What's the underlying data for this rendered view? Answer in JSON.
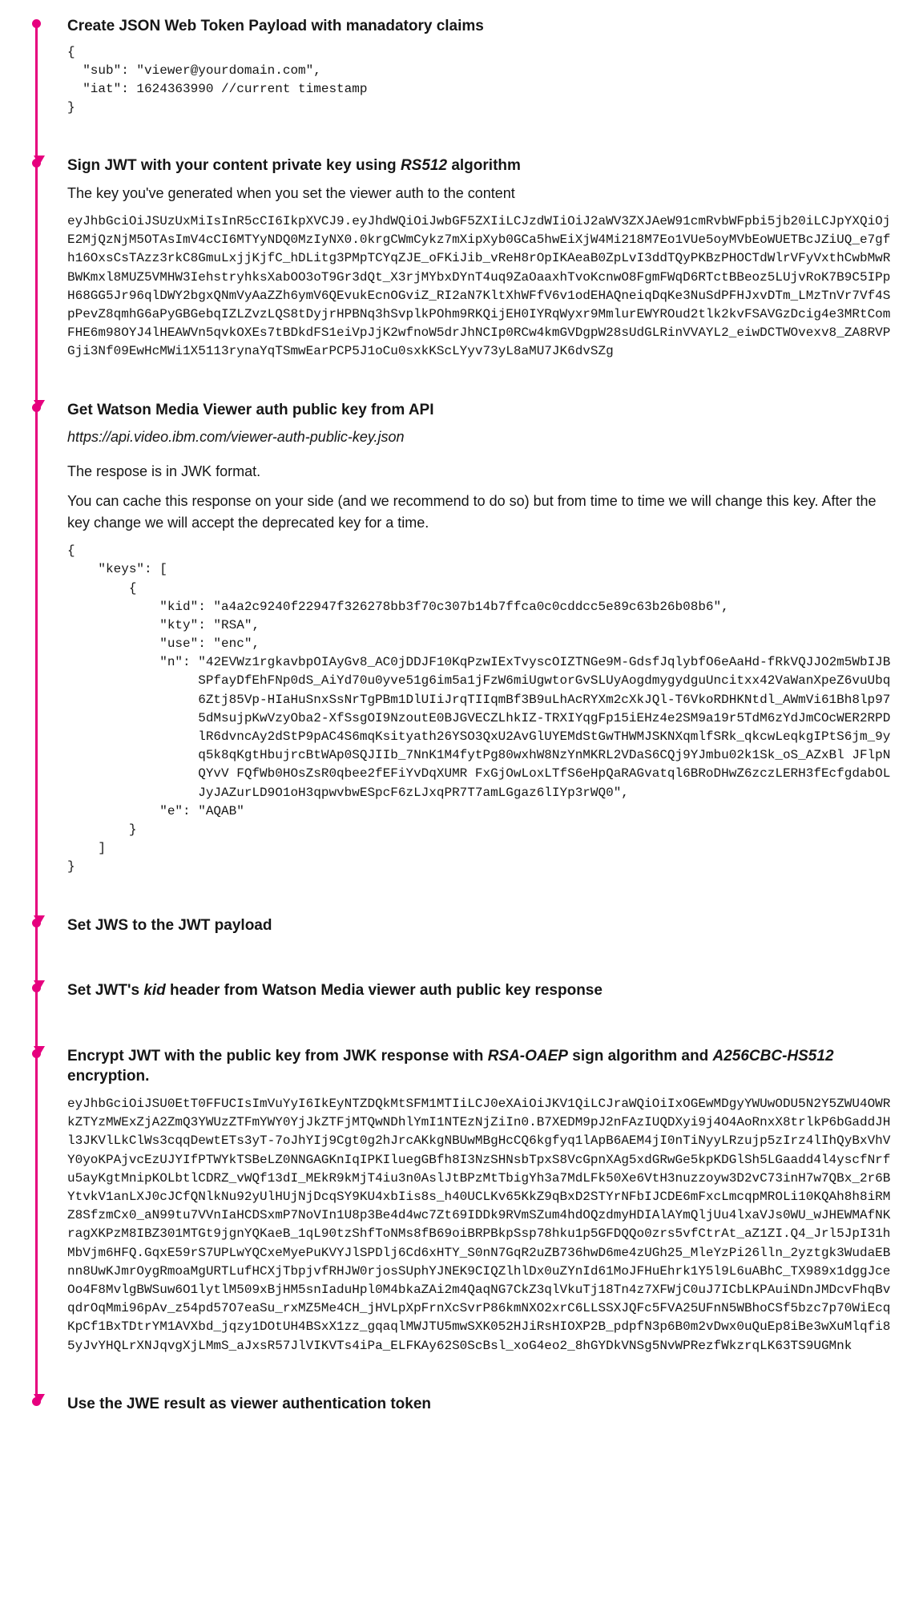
{
  "steps": {
    "s1": {
      "title": "Create JSON Web Token Payload with manadatory claims",
      "code": "{\n  \"sub\": \"viewer@yourdomain.com\",\n  \"iat\": 1624363990 //current timestamp\n}"
    },
    "s2": {
      "title_pre": "Sign JWT with your content private key using ",
      "title_em": "RS512",
      "title_post": " algorithm",
      "desc": "The key you've generated when you set the viewer auth to the content",
      "token": "eyJhbGciOiJSUzUxMiIsInR5cCI6IkpXVCJ9.eyJhdWQiOiJwbGF5ZXIiLCJzdWIiOiJ2aWV3ZXJAeW91cmRvbWFpbi5jb20iLCJpYXQiOjE2MjQzNjM5OTAsImV4cCI6MTYyNDQ0MzIyNX0.0krgCWmCykz7mXipXyb0GCa5hwEiXjW4Mi218M7Eo1VUe5oyMVbEoWUETBcJZiUQ_e7gfh16OxsCsTAzz3rkC8GmuLxjjKjfC_hDLitg3PMpTCYqZJE_oFKiJib_vReH8rOpIKAeaB0ZpLvI3ddTQyPKBzPHOCTdWlrVFyVxthCwbMwRBWKmxl8MUZ5VMHW3IehstryhksXabOO3oT9Gr3dQt_X3rjMYbxDYnT4uq9ZaOaaxhTvoKcnwO8FgmFWqD6RTctBBeoz5LUjvRoK7B9C5IPpH68GG5Jr96qlDWY2bgxQNmVyAaZZh6ymV6QEvukEcnOGviZ_RI2aN7KltXhWFfV6v1odEHAQneiqDqKe3NuSdPFHJxvDTm_LMzTnVr7Vf4SpPevZ8qmhG6aPyGBGebqIZLZvzLQS8tDyjrHPBNq3hSvplkPOhm9RKQijEH0IYRqWyxr9MmlurEWYROud2tlk2kvFSAVGzDcig4e3MRtComFHE6m98OYJ4lHEAWVn5qvkOXEs7tBDkdFS1eiVpJjK2wfnoW5drJhNCIp0RCw4kmGVDgpW28sUdGLRinVVAYL2_eiwDCTWOvexv8_ZA8RVPGji3Nf09EwHcMWi1X5113rynaYqTSmwEarPCP5J1oCu0sxkKScLYyv73yL8aMU7JK6dvSZg"
    },
    "s3": {
      "title": "Get Watson Media Viewer auth public key from API",
      "url": "https://api.video.ibm.com/viewer-auth-public-key.json",
      "desc1": "The respose is in JWK format.",
      "desc2": "You can cache this response on your side (and we recommend to do so) but from time to time we will change this key. After the key change we will accept the deprecated key for a time.",
      "jwk_open": "{\n    \"keys\": [\n        {\n            \"kid\": \"a4a2c9240f22947f326278bb3f70c307b14b7ffca0c0cddcc5e89c63b26b08b6\",\n            \"kty\": \"RSA\",\n            \"use\": \"enc\",",
      "n_label": "\"n\": ",
      "n_value": "\"42EVWz1rgkavbpOIAyGv8_AC0jDDJF10KqPzwIExTvyscOIZTNGe9M-GdsfJqlybfO6eAaHd-fRkVQJJO2m5WbIJBSPfayDfEhFNp0dS_AiYd70u0yve51g6im5a1jFzW6miUgwtorGvSLUyAogdmygydguUncitxx42VaWanXpeZ6vuUbq6Ztj85Vp-HIaHuSnxSsNrTgPBm1DlUIiJrqTIIqmBf3B9uLhAcRYXm2cXkJQl-T6VkoRDHKNtdl_AWmVi61Bh8lp975dMsujpKwVzyOba2-XfSsgOI9NzoutE0BJGVECZLhkIZ-TRXIYqgFp15iEHz4e2SM9a19r5TdM6zYdJmCOcWER2RPDlR6dvncAy2dStP9pAC4S6mqKsityath26YSO3QxU2AvGlUYEMdStGwTHWMJSKNXqmlfSRk_qkcwLeqkgIPtS6jm_9yq5k8qKgtHbujrcBtWAp0SQJIIb_7NnK1M4fytPg80wxhW8NzYnMKRL2VDaS6CQj9YJmbu02k1Sk_oS_AZxBl JFlpNQYvV FQfWb0HOsZsR0qbee2fEFiYvDqXUMR FxGjOwLoxLTfS6eHpQaRAGvatql6BRoDHwZ6zczLERH3fEcfgdabOLJyJAZurLD9O1oH3qpwvbwESpcF6zLJxqPR7T7amLGgaz6lIYp3rWQ0\",",
      "jwk_close": "            \"e\": \"AQAB\"\n        }\n    ]\n}"
    },
    "s4": {
      "title": "Set JWS to the JWT payload"
    },
    "s5": {
      "title_pre": "Set JWT's ",
      "title_em": "kid",
      "title_post": " header from Watson Media viewer auth public key response"
    },
    "s6": {
      "title_pre": "Encrypt JWT with the public key from JWK response with ",
      "title_em1": "RSA-OAEP",
      "title_mid": " sign algorithm and ",
      "title_em2": "A256CBC-HS512",
      "title_post": " encryption.",
      "token": "eyJhbGciOiJSU0EtT0FFUCIsImVuYyI6IkEyNTZDQkMtSFM1MTIiLCJ0eXAiOiJKV1QiLCJraWQiOiIxOGEwMDgyYWUwODU5N2Y5ZWU4OWRkZTYzMWExZjA2ZmQ3YWUzZTFmYWY0YjJkZTFjMTQwNDhlYmI1NTEzNjZiIn0.B7XEDM9pJ2nFAzIUQDXyi9j4O4AoRnxX8trlkP6bGaddJHl3JKVlLkClWs3cqqDewtETs3yT-7oJhYIj9Cgt0g2hJrcAKkgNBUwMBgHcCQ6kgfyq1lApB6AEM4jI0nTiNyyLRzujp5zIrz4lIhQyBxVhVY0yoKPAjvcEzUJYIfPTWYkTSBeLZ0NNGAGKnIqIPKIluegGBfh8I3NzSHNsbTpxS8VcGpnXAg5xdGRwGe5kpKDGlSh5LGaadd4l4yscfNrfu5ayKgtMnipKOLbtlCDRZ_vWQf13dI_MEkR9kMjT4iu3n0AslJtBPzMtTbigYh3a7MdLFk50Xe6VtH3nuzzoyw3D2vC73inH7w7QBx_2r6BYtvkV1anLXJ0cJCfQNlkNu92yUlHUjNjDcqSY9KU4xbIis8s_h40UCLKv65KkZ9qBxD2STYrNFbIJCDE6mFxcLmcqpMROLi10KQAh8h8iRMZ8SfzmCx0_aN99tu7VVnIaHCDSxmP7NoVIn1U8p3Be4d4wc7Zt69IDDk9RVmSZum4hdOQzdmyHDIAlAYmQljUu4lxaVJs0WU_wJHEWMAfNKragXKPzM8IBZ301MTGt9jgnYQKaeB_1qL90tzShfToNMs8fB69oiBRPBkpSsp78hku1p5GFDQQo0zrs5vfCtrAt_aZ1ZI.Q4_Jrl5JpI31hMbVjm6HFQ.GqxE59rS7UPLwYQCxeMyePuKVYJlSPDlj6Cd6xHTY_S0nN7GqR2uZB736hwD6me4zUGh25_MleYzPi26lln_2yztgk3WudaEBnn8UwKJmrOygRmoaMgURTLufHCXjTbpjvfRHJW0rjosSUphYJNEK9CIQZlhlDx0uZYnId61MoJFHuEhrk1Y5l9L6uABhC_TX989x1dggJceOo4F8MvlgBWSuw6O1lytlM509xBjHM5snIaduHpl0M4bkaZAi2m4QaqNG7CkZ3qlVkuTj18Tn4z7XFWjC0uJ7ICbLKPAuiNDnJMDcvFhqBvqdrOqMmi96pAv_z54pd57O7eaSu_rxMZ5Me4CH_jHVLpXpFrnXcSvrP86kmNXO2xrC6LLSSXJQFc5FVA25UFnN5WBhoCSf5bzc7p70WiEcqKpCf1BxTDtrYM1AVXbd_jqzy1DOtUH4BSxX1zz_gqaqlMWJTU5mwSXK052HJiRsHIOXP2B_pdpfN3p6B0m2vDwx0uQuEp8iBe3wXuMlqfi85yJvYHQLrXNJqvgXjLMmS_aJxsR57JlVIKVTs4iPa_ELFKAy62S0ScBsl_xoG4eo2_8hGYDkVNSg5NvWPRezfWkzrqLK63TS9UGMnk"
    },
    "s7": {
      "title": "Use the JWE result as viewer authentication token"
    }
  }
}
